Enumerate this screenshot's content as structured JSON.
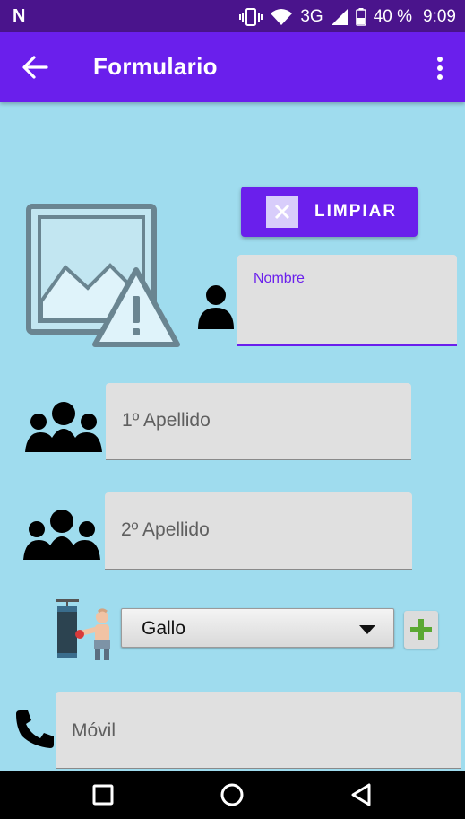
{
  "status_bar": {
    "network": "3G",
    "battery": "40 %",
    "time": "9:09",
    "icons": [
      "notification-n-icon",
      "vibrate-icon",
      "wifi-icon",
      "signal-icon",
      "battery-icon"
    ]
  },
  "app_bar": {
    "title": "Formulario",
    "back_icon": "arrow-back-icon",
    "menu_icon": "more-vert-icon",
    "color": "#6a1fec"
  },
  "form": {
    "clear_button_label": "LIMPIAR",
    "name_label": "Nombre",
    "surname1_placeholder": "1º Apellido",
    "surname2_placeholder": "2º Apellido",
    "category_selected": "Gallo",
    "phone_placeholder": "Móvil"
  },
  "nav_bar": {
    "buttons": [
      "recents-square-icon",
      "home-circle-icon",
      "back-triangle-icon"
    ]
  }
}
